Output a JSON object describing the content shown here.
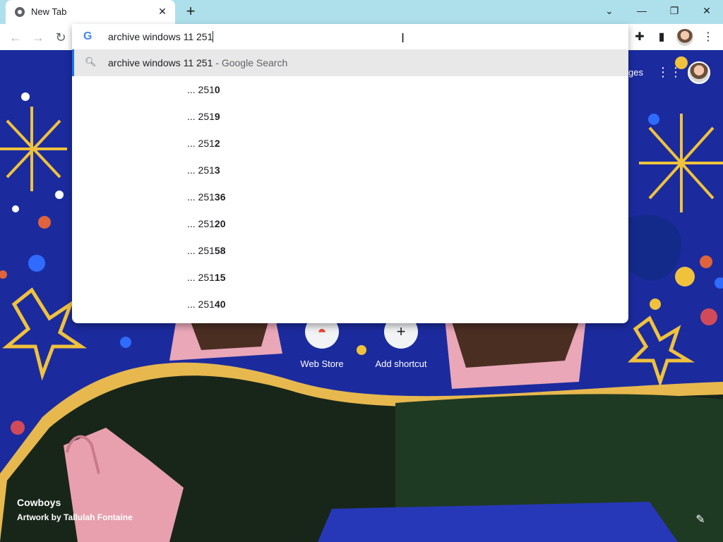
{
  "tab": {
    "title": "New Tab",
    "close_glyph": "✕",
    "icon": "chrome-icon"
  },
  "new_tab_glyph": "+",
  "window_controls": {
    "dropdown": "⌄",
    "minimize": "—",
    "restore": "❐",
    "close": "✕"
  },
  "toolbar": {
    "back": "←",
    "forward": "→",
    "reload": "↻",
    "extensions": "✚",
    "sidepanel": "▮",
    "menu": "⋮"
  },
  "omnibox": {
    "input_value": "archive windows 11 251",
    "google_glyph": "G",
    "top_suggestion": {
      "query": "archive windows 11 251",
      "suffix": " - Google Search"
    },
    "suggestions": [
      {
        "prefix": "... 251",
        "completion": "0"
      },
      {
        "prefix": "... 251",
        "completion": "9"
      },
      {
        "prefix": "... 251",
        "completion": "2"
      },
      {
        "prefix": "... 251",
        "completion": "3"
      },
      {
        "prefix": "... 251",
        "completion": "36"
      },
      {
        "prefix": "... 251",
        "completion": "20"
      },
      {
        "prefix": "... 251",
        "completion": "58"
      },
      {
        "prefix": "... 251",
        "completion": "15"
      },
      {
        "prefix": "... 251",
        "completion": "40"
      }
    ]
  },
  "ntp": {
    "top_link": "ges",
    "shortcuts": [
      {
        "label": "Web Store",
        "glyph": "◓"
      },
      {
        "label": "Add shortcut",
        "glyph": "+"
      }
    ],
    "background_credit": {
      "title": "Cowboys",
      "artist": "Artwork by Tallulah Fontaine"
    },
    "customize_glyph": "✎"
  },
  "colors": {
    "titlebar": "#aee0ec",
    "accent": "#1a73e8",
    "background": "#1a2a9a"
  }
}
